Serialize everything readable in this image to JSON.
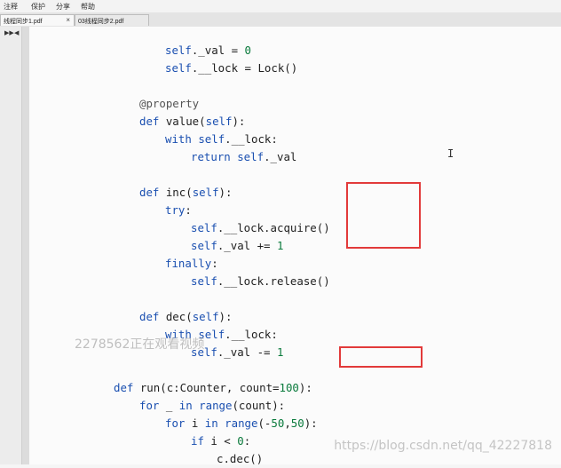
{
  "menu": [
    "注释",
    "保护",
    "分享",
    "帮助"
  ],
  "tabs": [
    {
      "label": "线程同步1.pdf",
      "close": "×"
    },
    {
      "label": "03线程同步2.pdf"
    }
  ],
  "nav": {
    "first": "▶▶",
    "prev": "◀"
  },
  "code_lines": [
    [
      {
        "t": "self",
        "c": "kw"
      },
      {
        "t": "._val = "
      },
      {
        "t": "0",
        "c": "num"
      }
    ],
    [
      {
        "t": "self",
        "c": "kw"
      },
      {
        "t": ".__lock = Lock()"
      }
    ],
    [],
    [
      {
        "t": "@property",
        "c": "dec"
      }
    ],
    [
      {
        "t": "def ",
        "c": "kw"
      },
      {
        "t": "value"
      },
      {
        "t": "("
      },
      {
        "t": "self",
        "c": "kw"
      },
      {
        "t": "):"
      }
    ],
    [
      {
        "t": "with ",
        "c": "kw"
      },
      {
        "t": "self",
        "c": "kw"
      },
      {
        "t": ".__lock:"
      }
    ],
    [
      {
        "t": "return ",
        "c": "kw"
      },
      {
        "t": "self",
        "c": "kw"
      },
      {
        "t": "._val"
      }
    ],
    [],
    [
      {
        "t": "def ",
        "c": "kw"
      },
      {
        "t": "inc"
      },
      {
        "t": "("
      },
      {
        "t": "self",
        "c": "kw"
      },
      {
        "t": "):"
      }
    ],
    [
      {
        "t": "try",
        "c": "kw"
      },
      {
        "t": ":"
      }
    ],
    [
      {
        "t": "self",
        "c": "kw"
      },
      {
        "t": ".__lock.acquire()"
      }
    ],
    [
      {
        "t": "self",
        "c": "kw"
      },
      {
        "t": "._val += "
      },
      {
        "t": "1",
        "c": "num"
      }
    ],
    [
      {
        "t": "finally",
        "c": "kw"
      },
      {
        "t": ":"
      }
    ],
    [
      {
        "t": "self",
        "c": "kw"
      },
      {
        "t": ".__lock.release()"
      }
    ],
    [],
    [
      {
        "t": "def ",
        "c": "kw"
      },
      {
        "t": "dec"
      },
      {
        "t": "("
      },
      {
        "t": "self",
        "c": "kw"
      },
      {
        "t": "):"
      }
    ],
    [
      {
        "t": "with ",
        "c": "kw"
      },
      {
        "t": "self",
        "c": "kw"
      },
      {
        "t": ".__lock:"
      }
    ],
    [
      {
        "t": "self",
        "c": "kw"
      },
      {
        "t": "._val -= "
      },
      {
        "t": "1",
        "c": "num"
      }
    ],
    [],
    [
      {
        "t": "def ",
        "c": "kw"
      },
      {
        "t": "run"
      },
      {
        "t": "(c:Counter, count="
      },
      {
        "t": "100",
        "c": "num"
      },
      {
        "t": "):"
      }
    ],
    [
      {
        "t": "for ",
        "c": "kw"
      },
      {
        "t": "_ "
      },
      {
        "t": "in ",
        "c": "kw"
      },
      {
        "t": "range",
        "c": "kw"
      },
      {
        "t": "(count):"
      }
    ],
    [
      {
        "t": "for ",
        "c": "kw"
      },
      {
        "t": "i "
      },
      {
        "t": "in ",
        "c": "kw"
      },
      {
        "t": "range",
        "c": "kw"
      },
      {
        "t": "(-"
      },
      {
        "t": "50",
        "c": "num"
      },
      {
        "t": ","
      },
      {
        "t": "50",
        "c": "num"
      },
      {
        "t": "):"
      }
    ],
    [
      {
        "t": "if ",
        "c": "kw"
      },
      {
        "t": "i < "
      },
      {
        "t": "0",
        "c": "num"
      },
      {
        "t": ":"
      }
    ],
    [
      {
        "t": "c.dec()"
      }
    ]
  ],
  "overlay_text": "2278562正在观看视频",
  "watermark": "https://blog.csdn.net/qq_42227818",
  "cursor_glyph": "I",
  "colors": {
    "keyword": "#1a4fb0",
    "number": "#0a7a3c",
    "annotation_box": "#e23a3a"
  }
}
